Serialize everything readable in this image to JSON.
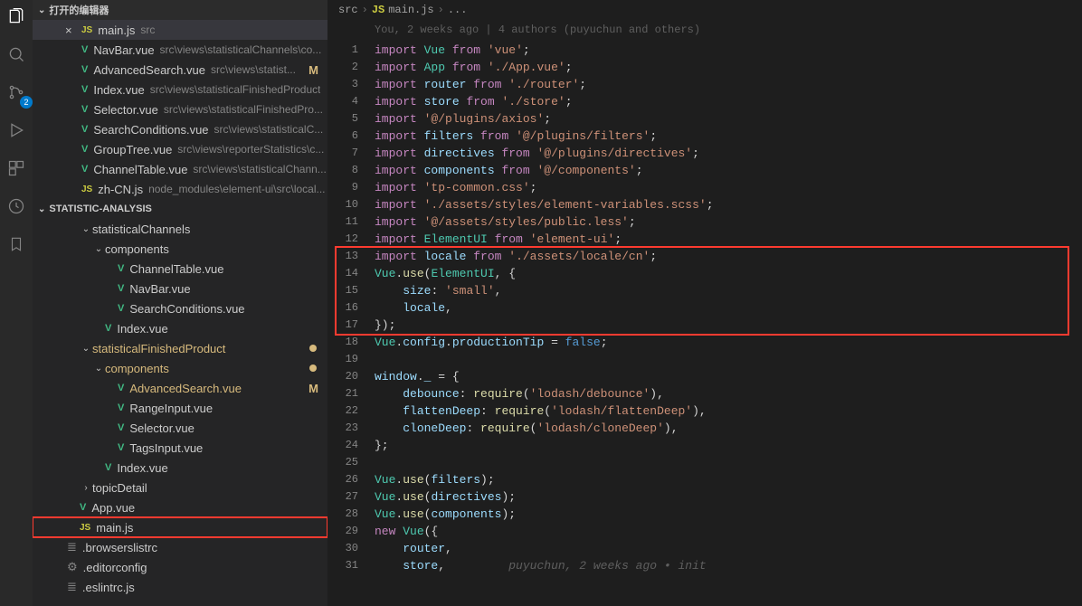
{
  "activity_badge": "2",
  "section_editors": "打开的编辑器",
  "project_name": "STATISTIC-ANALYSIS",
  "open_editors": [
    {
      "icon": "js",
      "name": "main.js",
      "path": "src",
      "active": true,
      "mod": ""
    },
    {
      "icon": "vue",
      "name": "NavBar.vue",
      "path": "src\\views\\statisticalChannels\\co...",
      "mod": ""
    },
    {
      "icon": "vue",
      "name": "AdvancedSearch.vue",
      "path": "src\\views\\statist...",
      "mod": "M"
    },
    {
      "icon": "vue",
      "name": "Index.vue",
      "path": "src\\views\\statisticalFinishedProduct",
      "mod": ""
    },
    {
      "icon": "vue",
      "name": "Selector.vue",
      "path": "src\\views\\statisticalFinishedPro...",
      "mod": ""
    },
    {
      "icon": "vue",
      "name": "SearchConditions.vue",
      "path": "src\\views\\statisticalC...",
      "mod": ""
    },
    {
      "icon": "vue",
      "name": "GroupTree.vue",
      "path": "src\\views\\reporterStatistics\\c...",
      "mod": ""
    },
    {
      "icon": "vue",
      "name": "ChannelTable.vue",
      "path": "src\\views\\statisticalChann...",
      "mod": ""
    },
    {
      "icon": "js",
      "name": "zh-CN.js",
      "path": "node_modules\\element-ui\\src\\local...",
      "mod": ""
    }
  ],
  "tree": [
    {
      "depth": 3,
      "chev": "v",
      "name": "statisticalChannels",
      "icon": "",
      "mod": ""
    },
    {
      "depth": 4,
      "chev": "v",
      "name": "components",
      "icon": "",
      "mod": ""
    },
    {
      "depth": 5,
      "chev": "",
      "name": "ChannelTable.vue",
      "icon": "vue",
      "mod": ""
    },
    {
      "depth": 5,
      "chev": "",
      "name": "NavBar.vue",
      "icon": "vue",
      "mod": ""
    },
    {
      "depth": 5,
      "chev": "",
      "name": "SearchConditions.vue",
      "icon": "vue",
      "mod": ""
    },
    {
      "depth": 4,
      "chev": "",
      "name": "Index.vue",
      "icon": "vue",
      "mod": ""
    },
    {
      "depth": 3,
      "chev": "v",
      "name": "statisticalFinishedProduct",
      "icon": "",
      "mod": "dot"
    },
    {
      "depth": 4,
      "chev": "v",
      "name": "components",
      "icon": "",
      "mod": "dot"
    },
    {
      "depth": 5,
      "chev": "",
      "name": "AdvancedSearch.vue",
      "icon": "vue",
      "mod": "M"
    },
    {
      "depth": 5,
      "chev": "",
      "name": "RangeInput.vue",
      "icon": "vue",
      "mod": ""
    },
    {
      "depth": 5,
      "chev": "",
      "name": "Selector.vue",
      "icon": "vue",
      "mod": ""
    },
    {
      "depth": 5,
      "chev": "",
      "name": "TagsInput.vue",
      "icon": "vue",
      "mod": ""
    },
    {
      "depth": 4,
      "chev": "",
      "name": "Index.vue",
      "icon": "vue",
      "mod": ""
    },
    {
      "depth": 3,
      "chev": ">",
      "name": "topicDetail",
      "icon": "",
      "mod": ""
    },
    {
      "depth": 2,
      "chev": "",
      "name": "App.vue",
      "icon": "vue",
      "mod": ""
    },
    {
      "depth": 2,
      "chev": "",
      "name": "main.js",
      "icon": "js",
      "mod": "",
      "hilite": true
    },
    {
      "depth": 1,
      "chev": "",
      "name": ".browserslistrc",
      "icon": "cfg",
      "mod": ""
    },
    {
      "depth": 1,
      "chev": "",
      "name": ".editorconfig",
      "icon": "gear",
      "mod": ""
    },
    {
      "depth": 1,
      "chev": "",
      "name": ".eslintrc.js",
      "icon": "cfg",
      "mod": ""
    }
  ],
  "breadcrumb": {
    "folder": "src",
    "icon": "JS",
    "file": "main.js",
    "tail": "..."
  },
  "blame": "You, 2 weeks ago | 4 authors (puyuchun and others)",
  "code": [
    [
      [
        "kw",
        "import"
      ],
      [
        "punc",
        " "
      ],
      [
        "type",
        "Vue"
      ],
      [
        "punc",
        " "
      ],
      [
        "kw",
        "from"
      ],
      [
        "punc",
        " "
      ],
      [
        "str",
        "'vue'"
      ],
      [
        "punc",
        ";"
      ]
    ],
    [
      [
        "kw",
        "import"
      ],
      [
        "punc",
        " "
      ],
      [
        "type",
        "App"
      ],
      [
        "punc",
        " "
      ],
      [
        "kw",
        "from"
      ],
      [
        "punc",
        " "
      ],
      [
        "str",
        "'./App.vue'"
      ],
      [
        "punc",
        ";"
      ]
    ],
    [
      [
        "kw",
        "import"
      ],
      [
        "punc",
        " "
      ],
      [
        "var",
        "router"
      ],
      [
        "punc",
        " "
      ],
      [
        "kw",
        "from"
      ],
      [
        "punc",
        " "
      ],
      [
        "str",
        "'./router'"
      ],
      [
        "punc",
        ";"
      ]
    ],
    [
      [
        "kw",
        "import"
      ],
      [
        "punc",
        " "
      ],
      [
        "var",
        "store"
      ],
      [
        "punc",
        " "
      ],
      [
        "kw",
        "from"
      ],
      [
        "punc",
        " "
      ],
      [
        "str",
        "'./store'"
      ],
      [
        "punc",
        ";"
      ]
    ],
    [
      [
        "kw",
        "import"
      ],
      [
        "punc",
        " "
      ],
      [
        "str",
        "'@/plugins/axios'"
      ],
      [
        "punc",
        ";"
      ]
    ],
    [
      [
        "kw",
        "import"
      ],
      [
        "punc",
        " "
      ],
      [
        "var",
        "filters"
      ],
      [
        "punc",
        " "
      ],
      [
        "kw",
        "from"
      ],
      [
        "punc",
        " "
      ],
      [
        "str",
        "'@/plugins/filters'"
      ],
      [
        "punc",
        ";"
      ]
    ],
    [
      [
        "kw",
        "import"
      ],
      [
        "punc",
        " "
      ],
      [
        "var",
        "directives"
      ],
      [
        "punc",
        " "
      ],
      [
        "kw",
        "from"
      ],
      [
        "punc",
        " "
      ],
      [
        "str",
        "'@/plugins/directives'"
      ],
      [
        "punc",
        ";"
      ]
    ],
    [
      [
        "kw",
        "import"
      ],
      [
        "punc",
        " "
      ],
      [
        "var",
        "components"
      ],
      [
        "punc",
        " "
      ],
      [
        "kw",
        "from"
      ],
      [
        "punc",
        " "
      ],
      [
        "str",
        "'@/components'"
      ],
      [
        "punc",
        ";"
      ]
    ],
    [
      [
        "kw",
        "import"
      ],
      [
        "punc",
        " "
      ],
      [
        "str",
        "'tp-common.css'"
      ],
      [
        "punc",
        ";"
      ]
    ],
    [
      [
        "kw",
        "import"
      ],
      [
        "punc",
        " "
      ],
      [
        "str",
        "'./assets/styles/element-variables.scss'"
      ],
      [
        "punc",
        ";"
      ]
    ],
    [
      [
        "kw",
        "import"
      ],
      [
        "punc",
        " "
      ],
      [
        "str",
        "'@/assets/styles/public.less'"
      ],
      [
        "punc",
        ";"
      ]
    ],
    [
      [
        "kw",
        "import"
      ],
      [
        "punc",
        " "
      ],
      [
        "type",
        "ElementUI"
      ],
      [
        "punc",
        " "
      ],
      [
        "kw",
        "from"
      ],
      [
        "punc",
        " "
      ],
      [
        "str",
        "'element-ui'"
      ],
      [
        "punc",
        ";"
      ]
    ],
    [
      [
        "kw",
        "import"
      ],
      [
        "punc",
        " "
      ],
      [
        "var",
        "locale"
      ],
      [
        "punc",
        " "
      ],
      [
        "kw",
        "from"
      ],
      [
        "punc",
        " "
      ],
      [
        "str",
        "'./assets/locale/cn'"
      ],
      [
        "punc",
        ";"
      ]
    ],
    [
      [
        "type",
        "Vue"
      ],
      [
        "punc",
        "."
      ],
      [
        "fn",
        "use"
      ],
      [
        "punc",
        "("
      ],
      [
        "type",
        "ElementUI"
      ],
      [
        "punc",
        ", {"
      ]
    ],
    [
      [
        "punc",
        "    "
      ],
      [
        "prop",
        "size"
      ],
      [
        "punc",
        ": "
      ],
      [
        "str",
        "'small'"
      ],
      [
        "punc",
        ","
      ]
    ],
    [
      [
        "punc",
        "    "
      ],
      [
        "var",
        "locale"
      ],
      [
        "punc",
        ","
      ]
    ],
    [
      [
        "punc",
        "});"
      ]
    ],
    [
      [
        "type",
        "Vue"
      ],
      [
        "punc",
        "."
      ],
      [
        "prop",
        "config"
      ],
      [
        "punc",
        "."
      ],
      [
        "prop",
        "productionTip"
      ],
      [
        "punc",
        " = "
      ],
      [
        "const",
        "false"
      ],
      [
        "punc",
        ";"
      ]
    ],
    [],
    [
      [
        "var",
        "window"
      ],
      [
        "punc",
        "."
      ],
      [
        "prop",
        "_"
      ],
      [
        "punc",
        " = {"
      ]
    ],
    [
      [
        "punc",
        "    "
      ],
      [
        "prop",
        "debounce"
      ],
      [
        "punc",
        ": "
      ],
      [
        "fn",
        "require"
      ],
      [
        "punc",
        "("
      ],
      [
        "str",
        "'lodash/debounce'"
      ],
      [
        "punc",
        "),"
      ]
    ],
    [
      [
        "punc",
        "    "
      ],
      [
        "prop",
        "flattenDeep"
      ],
      [
        "punc",
        ": "
      ],
      [
        "fn",
        "require"
      ],
      [
        "punc",
        "("
      ],
      [
        "str",
        "'lodash/flattenDeep'"
      ],
      [
        "punc",
        "),"
      ]
    ],
    [
      [
        "punc",
        "    "
      ],
      [
        "prop",
        "cloneDeep"
      ],
      [
        "punc",
        ": "
      ],
      [
        "fn",
        "require"
      ],
      [
        "punc",
        "("
      ],
      [
        "str",
        "'lodash/cloneDeep'"
      ],
      [
        "punc",
        "),"
      ]
    ],
    [
      [
        "punc",
        "};"
      ]
    ],
    [],
    [
      [
        "type",
        "Vue"
      ],
      [
        "punc",
        "."
      ],
      [
        "fn",
        "use"
      ],
      [
        "punc",
        "("
      ],
      [
        "var",
        "filters"
      ],
      [
        "punc",
        ");"
      ]
    ],
    [
      [
        "type",
        "Vue"
      ],
      [
        "punc",
        "."
      ],
      [
        "fn",
        "use"
      ],
      [
        "punc",
        "("
      ],
      [
        "var",
        "directives"
      ],
      [
        "punc",
        ");"
      ]
    ],
    [
      [
        "type",
        "Vue"
      ],
      [
        "punc",
        "."
      ],
      [
        "fn",
        "use"
      ],
      [
        "punc",
        "("
      ],
      [
        "var",
        "components"
      ],
      [
        "punc",
        ");"
      ]
    ],
    [
      [
        "kw",
        "new"
      ],
      [
        "punc",
        " "
      ],
      [
        "type",
        "Vue"
      ],
      [
        "punc",
        "({"
      ]
    ],
    [
      [
        "punc",
        "    "
      ],
      [
        "var",
        "router"
      ],
      [
        "punc",
        ","
      ]
    ],
    [
      [
        "punc",
        "    "
      ],
      [
        "var",
        "store"
      ],
      [
        "punc",
        ","
      ],
      [
        "comment",
        "         puyuchun, 2 weeks ago • init"
      ]
    ]
  ],
  "highlight_lines": {
    "start": 13,
    "end": 17
  }
}
